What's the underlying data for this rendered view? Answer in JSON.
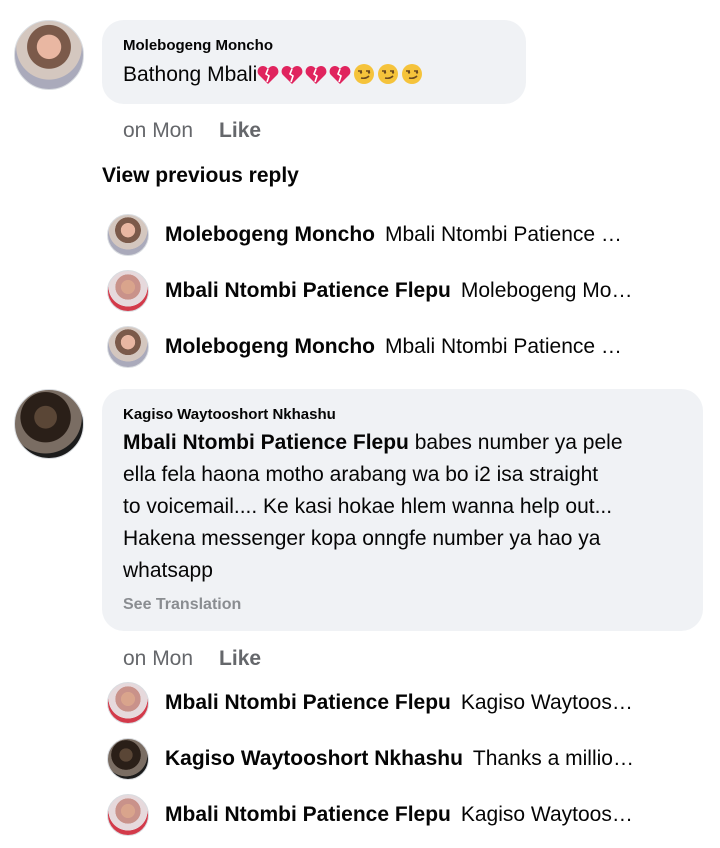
{
  "comment1": {
    "author": "Molebogeng Moncho",
    "text": "Bathong Mbali",
    "emojis": [
      "broken-heart",
      "broken-heart",
      "broken-heart",
      "broken-heart",
      "smirk",
      "smirk",
      "smirk"
    ],
    "time": "on Mon",
    "like": "Like"
  },
  "view_previous": "View previous reply",
  "replies1": [
    {
      "name": "Molebogeng Moncho",
      "text": "Mbali Ntombi Patience …",
      "avatar": "molebogeng"
    },
    {
      "name": "Mbali Ntombi Patience Flepu",
      "text": "Molebogeng Mo…",
      "avatar": "mbali"
    },
    {
      "name": "Molebogeng Moncho",
      "text": "Mbali Ntombi Patience …",
      "avatar": "molebogeng"
    }
  ],
  "comment2": {
    "author": "Kagiso Waytooshort Nkhashu",
    "mention": "Mbali Ntombi Patience Flepu",
    "line1": " babes number ya pele",
    "line2": "ella fela haona motho arabang wa bo i2 isa straight",
    "line3": "to voicemail.... Ke kasi hokae hlem wanna help out...",
    "line4": "Hakena messenger kopa onngfe number ya hao ya",
    "line5": "whatsapp",
    "see_translation": "See Translation",
    "time": "on Mon",
    "like": "Like"
  },
  "replies2": [
    {
      "name": "Mbali Ntombi Patience Flepu",
      "text": "Kagiso Waytoos…",
      "avatar": "mbali"
    },
    {
      "name": "Kagiso Waytooshort Nkhashu",
      "text": "Thanks a millio…",
      "avatar": "kagiso"
    },
    {
      "name": "Mbali Ntombi Patience Flepu",
      "text": "Kagiso Waytoos…",
      "avatar": "mbali"
    }
  ],
  "colors": {
    "bubble": "#f0f2f5",
    "meta": "#65676b",
    "broken_heart": "#e0245e",
    "smirk": "#f5c33b"
  }
}
